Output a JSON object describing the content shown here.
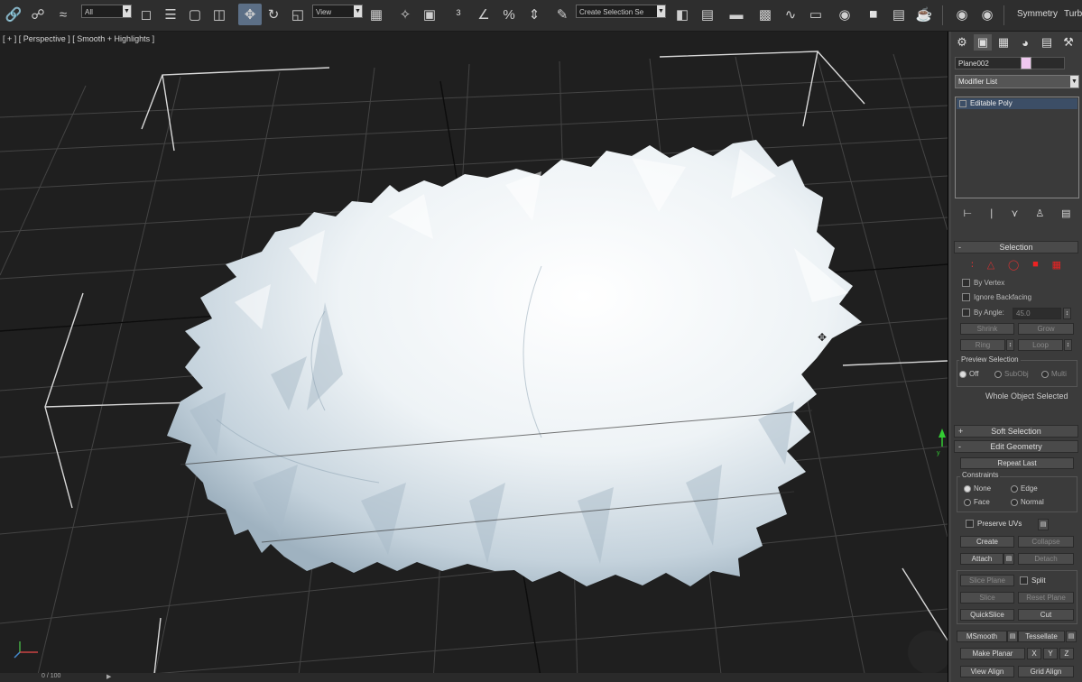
{
  "toolbar": {
    "selection_filter": "All",
    "reference_coord": "View",
    "named_selection": "Create Selection Se",
    "modifier_symmetry": "Symmetry",
    "modifier_turbo": "Turb"
  },
  "viewport": {
    "label": "[ + ] [ Perspective ] [ Smooth + Highlights ]",
    "axis_y_label": "y",
    "timeline_label": "0 / 100"
  },
  "command_panel": {
    "object_name": "Plane002",
    "object_color": "#f0c8f0",
    "modifier_list": "Modifier List",
    "stack": [
      {
        "label": "Editable Poly"
      }
    ],
    "selection": {
      "title": "Selection",
      "by_vertex": "By Vertex",
      "ignore_backfacing": "Ignore Backfacing",
      "by_angle": "By Angle:",
      "by_angle_value": "45.0",
      "shrink": "Shrink",
      "grow": "Grow",
      "ring": "Ring",
      "loop": "Loop",
      "preview_selection": "Preview Selection",
      "preview_options": [
        "Off",
        "SubObj",
        "Multi"
      ],
      "status": "Whole Object Selected"
    },
    "soft_selection": {
      "title": "Soft Selection"
    },
    "edit_geometry": {
      "title": "Edit Geometry",
      "repeat_last": "Repeat Last",
      "constraints": "Constraints",
      "constraint_options": [
        "None",
        "Edge",
        "Face",
        "Normal"
      ],
      "preserve_uvs": "Preserve UVs",
      "create": "Create",
      "collapse": "Collapse",
      "attach": "Attach",
      "detach": "Detach",
      "slice_plane": "Slice Plane",
      "split": "Split",
      "slice": "Slice",
      "reset_plane": "Reset Plane",
      "quickslice": "QuickSlice",
      "cut": "Cut",
      "msmooth": "MSmooth",
      "tessellate": "Tessellate",
      "make_planar": "Make Planar",
      "x": "X",
      "y": "Y",
      "z": "Z",
      "view_align": "View Align",
      "grid_align": "Grid Align"
    }
  }
}
